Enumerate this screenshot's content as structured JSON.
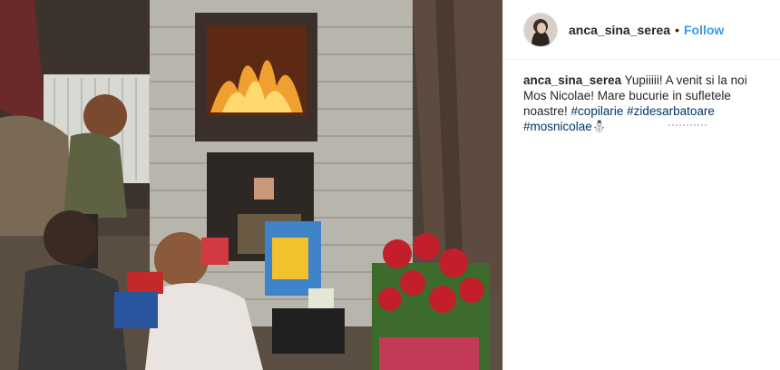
{
  "post": {
    "username": "anca_sina_serea",
    "separator": "•",
    "follow_label": "Follow",
    "caption_user": "anca_sina_serea",
    "caption_text": "Yupiiiii! A venit si la noi Mos Nicolae! Mare bucurie in sufletele noastre!",
    "hashtags": [
      "#copilarie",
      "#zidesarbatoare",
      "#mosnicolae"
    ],
    "emoji": "⛄",
    "photo_icon": "family-fireplace-photo",
    "colors": {
      "link": "#3897f0",
      "hashtag": "#003569",
      "text": "#262626"
    }
  }
}
